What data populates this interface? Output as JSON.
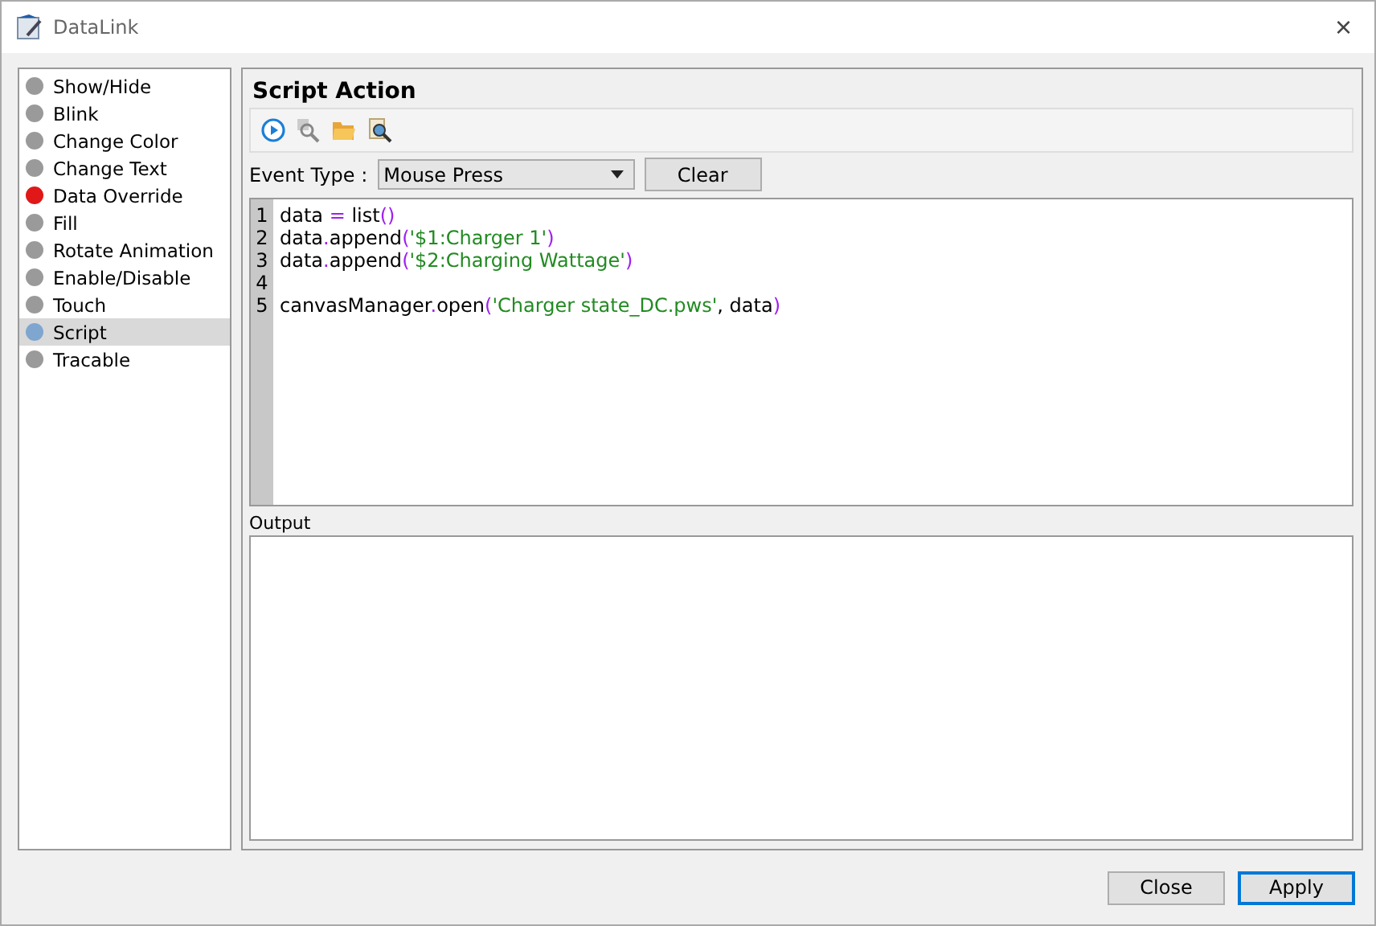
{
  "window": {
    "title": "DataLink",
    "close": "×"
  },
  "sidebar": {
    "items": [
      {
        "label": "Show/Hide",
        "color": "#9a9a9a",
        "selected": false
      },
      {
        "label": "Blink",
        "color": "#9a9a9a",
        "selected": false
      },
      {
        "label": "Change Color",
        "color": "#9a9a9a",
        "selected": false
      },
      {
        "label": "Change Text",
        "color": "#9a9a9a",
        "selected": false
      },
      {
        "label": "Data Override",
        "color": "#e01818",
        "selected": false
      },
      {
        "label": "Fill",
        "color": "#9a9a9a",
        "selected": false
      },
      {
        "label": "Rotate Animation",
        "color": "#9a9a9a",
        "selected": false
      },
      {
        "label": "Enable/Disable",
        "color": "#9a9a9a",
        "selected": false
      },
      {
        "label": "Touch",
        "color": "#9a9a9a",
        "selected": false
      },
      {
        "label": "Script",
        "color": "#7fa6cf",
        "selected": true
      },
      {
        "label": "Tracable",
        "color": "#9a9a9a",
        "selected": false
      }
    ]
  },
  "panel": {
    "title": "Script Action",
    "event_type_label": "Event Type :",
    "event_type": "Mouse Press",
    "clear_button": "Clear",
    "code": [
      {
        "number": "1",
        "tokens": [
          {
            "kind": "plain",
            "text": "data "
          },
          {
            "kind": "op",
            "text": "="
          },
          {
            "kind": "plain",
            "text": " list"
          },
          {
            "kind": "op",
            "text": "()"
          }
        ]
      },
      {
        "number": "2",
        "tokens": [
          {
            "kind": "plain",
            "text": "data"
          },
          {
            "kind": "op",
            "text": "."
          },
          {
            "kind": "plain",
            "text": "append"
          },
          {
            "kind": "op",
            "text": "("
          },
          {
            "kind": "str",
            "text": "'$1:Charger 1'"
          },
          {
            "kind": "op",
            "text": ")"
          }
        ]
      },
      {
        "number": "3",
        "tokens": [
          {
            "kind": "plain",
            "text": "data"
          },
          {
            "kind": "op",
            "text": "."
          },
          {
            "kind": "plain",
            "text": "append"
          },
          {
            "kind": "op",
            "text": "("
          },
          {
            "kind": "str",
            "text": "'$2:Charging Wattage'"
          },
          {
            "kind": "op",
            "text": ")"
          }
        ]
      },
      {
        "number": "4"
      },
      {
        "number": "5",
        "tokens": [
          {
            "kind": "plain",
            "text": "canvasManager"
          },
          {
            "kind": "op",
            "text": "."
          },
          {
            "kind": "plain",
            "text": "open"
          },
          {
            "kind": "op",
            "text": "("
          },
          {
            "kind": "str",
            "text": "'Charger state_DC.pws'"
          },
          {
            "kind": "plain",
            "text": ", data"
          },
          {
            "kind": "op",
            "text": ")"
          }
        ]
      }
    ],
    "output_label": "Output"
  },
  "buttons": [
    {
      "label": "Close",
      "default": false
    },
    {
      "label": "Apply",
      "default": true
    }
  ]
}
